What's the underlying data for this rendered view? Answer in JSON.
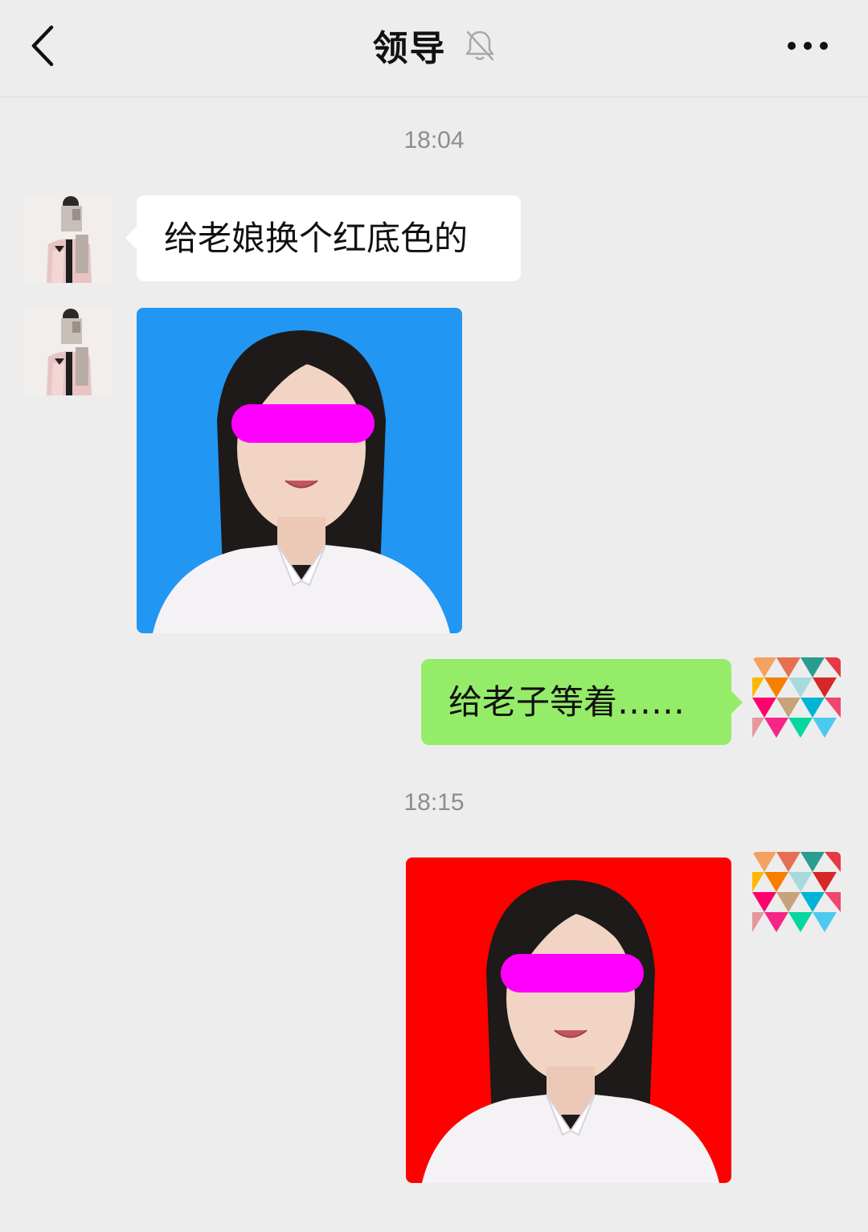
{
  "header": {
    "title": "领导",
    "back_icon": "chevron-left-icon",
    "mute_icon": "bell-off-icon",
    "more_icon": "more-horizontal-icon"
  },
  "colors": {
    "background": "#ededed",
    "incoming_bubble": "#ffffff",
    "outgoing_bubble": "#95ec69",
    "photo1_background": "#2196f3",
    "photo2_background": "#ff0000",
    "censor_bar": "#ff00ff"
  },
  "chat": {
    "timestamp_1": "18:04",
    "msg_1_text": "给老娘换个红底色的",
    "msg_2_type": "image",
    "msg_3_text": "给老子等着……",
    "timestamp_2": "18:15",
    "msg_4_type": "image"
  }
}
